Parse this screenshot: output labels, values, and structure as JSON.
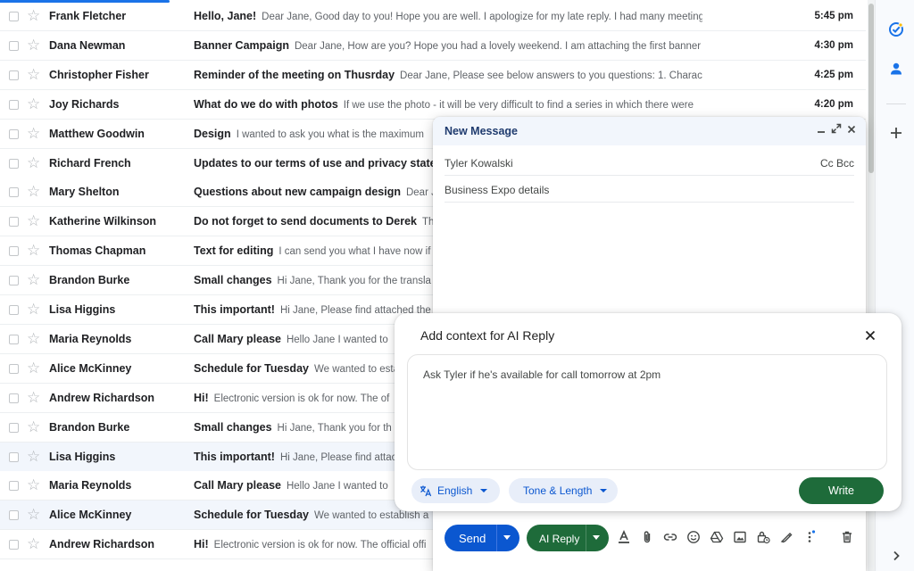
{
  "mail_list": {
    "rows": [
      {
        "sender": "Frank Fletcher",
        "subject": "Hello, Jane!",
        "snippet": "Dear Jane, Good day to you! Hope you are well. I apologize for my late reply. I had many meeting",
        "time": "5:45 pm"
      },
      {
        "sender": "Dana Newman",
        "subject": "Banner Campaign",
        "snippet": "Dear Jane, How are you? Hope you had a lovely weekend. I am attaching the first banner",
        "time": "4:30 pm"
      },
      {
        "sender": "Christopher Fisher",
        "subject": "Reminder of the meeting on Thusrday",
        "snippet": "Dear Jane, Please see below answers to you questions: 1. Charact",
        "time": "4:25 pm"
      },
      {
        "sender": "Joy Richards",
        "subject": "What do we do with photos",
        "snippet": "If we use the photo - it will be very difficult to find a series in which there were",
        "time": "4:20 pm"
      },
      {
        "sender": "Matthew Goodwin",
        "subject": "Design",
        "snippet": "I wanted to ask you what is the maximum",
        "time": ""
      },
      {
        "sender": "Richard French",
        "subject": "Updates to our terms of use and privacy statem",
        "snippet": "",
        "time": ""
      },
      {
        "sender": "Mary Shelton",
        "subject": "Questions about new campaign design",
        "snippet": "Dear Ja",
        "time": ""
      },
      {
        "sender": "Katherine Wilkinson",
        "subject": "Do not forget to send documents to Derek",
        "snippet": "Th",
        "time": ""
      },
      {
        "sender": "Thomas Chapman",
        "subject": "Text for editing",
        "snippet": "I can send you what I have now if",
        "time": ""
      },
      {
        "sender": "Brandon Burke",
        "subject": "Small changes",
        "snippet": "Hi Jane, Thank you for the transla",
        "time": ""
      },
      {
        "sender": "Lisa Higgins",
        "subject": "This important!",
        "snippet": "Hi Jane, Please find attached the t",
        "time": ""
      },
      {
        "sender": "Maria Reynolds",
        "subject": "Call Mary please",
        "snippet": "Hello Jane I wanted to",
        "time": ""
      },
      {
        "sender": "Alice McKinney",
        "subject": "Schedule for Tuesday",
        "snippet": "We wanted to estab",
        "time": ""
      },
      {
        "sender": "Andrew Richardson",
        "subject": "Hi!",
        "snippet": "Electronic version is ok for now. The of",
        "time": ""
      },
      {
        "sender": "Brandon Burke",
        "subject": "Small changes",
        "snippet": "Hi Jane, Thank you for th",
        "time": ""
      },
      {
        "sender": "Lisa Higgins",
        "subject": "This important!",
        "snippet": "Hi Jane, Please find attac",
        "time": ""
      },
      {
        "sender": "Maria Reynolds",
        "subject": "Call Mary please",
        "snippet": "Hello Jane I wanted to",
        "time": ""
      },
      {
        "sender": "Alice McKinney",
        "subject": "Schedule for Tuesday",
        "snippet": "We wanted to establish a",
        "time": ""
      },
      {
        "sender": "Andrew Richardson",
        "subject": "Hi!",
        "snippet": "Electronic version is ok for now. The official offi",
        "time": ""
      }
    ]
  },
  "compose": {
    "title": "New Message",
    "to": "Tyler Kowalski",
    "cc_bcc": "Cc Bcc",
    "subject": "Business Expo details",
    "send_label": "Send",
    "ai_reply_label": "AI Reply"
  },
  "ai_popup": {
    "title": "Add context for AI Reply",
    "context_text": "Ask Tyler if he's available for call tomorrow at 2pm",
    "language_label": "English",
    "tone_label": "Tone & Length",
    "write_label": "Write"
  },
  "colors": {
    "accent_blue": "#0b57d0",
    "ai_green": "#1e6b3a",
    "selected_row": "#f2f6fc"
  },
  "icons": {
    "side_panel": [
      "tasks-icon",
      "contacts-icon",
      "add-icon",
      "chevron-right-icon"
    ],
    "toolbar": [
      "text-format-icon",
      "attach-icon",
      "link-icon",
      "emoji-icon",
      "drive-icon",
      "photo-icon",
      "lock-clock-icon",
      "signature-icon",
      "more-options-icon",
      "trash-icon"
    ]
  }
}
